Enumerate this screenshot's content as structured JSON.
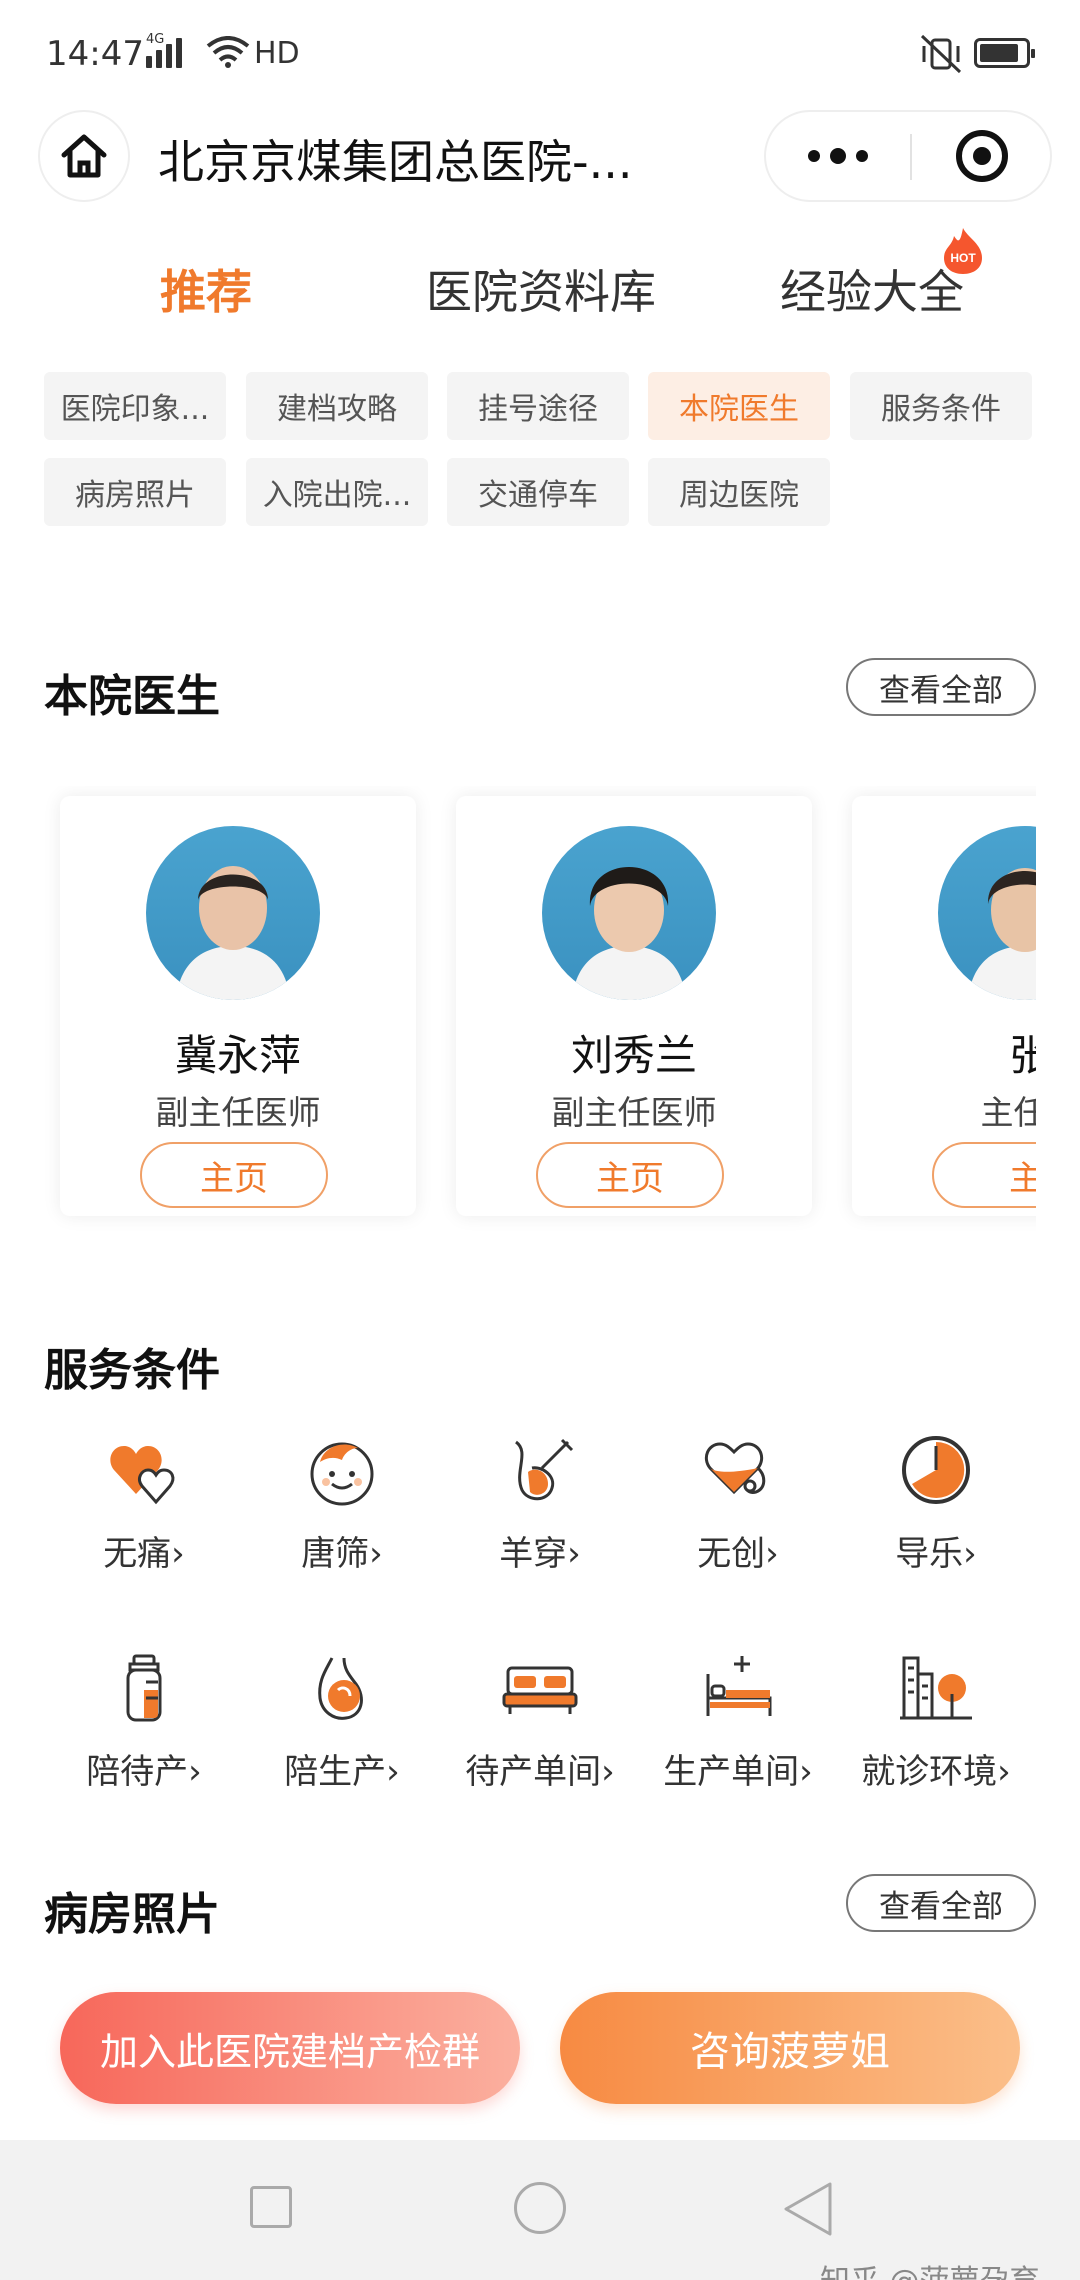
{
  "status_bar": {
    "time": "14:47",
    "network": "4G",
    "hd": "HD"
  },
  "header": {
    "title": "北京京煤集团总医院-..."
  },
  "main_tabs": [
    {
      "label": "推荐",
      "active": true
    },
    {
      "label": "医院资料库",
      "active": false
    },
    {
      "label": "经验大全",
      "active": false,
      "badge": "HOT"
    }
  ],
  "chips": [
    {
      "label": "医院印象...",
      "active": false
    },
    {
      "label": "建档攻略",
      "active": false
    },
    {
      "label": "挂号途径",
      "active": false
    },
    {
      "label": "本院医生",
      "active": true
    },
    {
      "label": "服务条件",
      "active": false
    },
    {
      "label": "病房照片",
      "active": false
    },
    {
      "label": "入院出院...",
      "active": false
    },
    {
      "label": "交通停车",
      "active": false
    },
    {
      "label": "周边医院",
      "active": false
    }
  ],
  "doctors_section": {
    "title": "本院医生",
    "view_all": "查看全部",
    "doctors": [
      {
        "name": "冀永萍",
        "title": "副主任医师",
        "button": "主页"
      },
      {
        "name": "刘秀兰",
        "title": "副主任医师",
        "button": "主页"
      },
      {
        "name": "张",
        "title": "主任医",
        "button": "主"
      }
    ]
  },
  "services_section": {
    "title": "服务条件",
    "items": [
      {
        "label": "无痛›",
        "icon": "hearts-icon"
      },
      {
        "label": "唐筛›",
        "icon": "baby-face-icon"
      },
      {
        "label": "羊穿›",
        "icon": "amniocentesis-icon"
      },
      {
        "label": "无创›",
        "icon": "heart-stethoscope-icon"
      },
      {
        "label": "导乐›",
        "icon": "doula-timer-icon"
      },
      {
        "label": "陪待产›",
        "icon": "bottle-icon"
      },
      {
        "label": "陪生产›",
        "icon": "pregnant-belly-icon"
      },
      {
        "label": "待产单间›",
        "icon": "bed-icon"
      },
      {
        "label": "生产单间›",
        "icon": "hospital-bed-icon"
      },
      {
        "label": "就诊环境›",
        "icon": "building-tree-icon"
      }
    ]
  },
  "ward_section": {
    "title": "病房照片",
    "view_all": "查看全部"
  },
  "actions": {
    "join_group": "加入此医院建档产检群",
    "consult": "咨询菠萝姐"
  },
  "watermark": "知乎 @菠萝孕育",
  "colors": {
    "accent": "#f07a2c",
    "accent_light": "#fdeee4",
    "group_btn": "#f7675a",
    "consult_btn": "#f78a42"
  }
}
